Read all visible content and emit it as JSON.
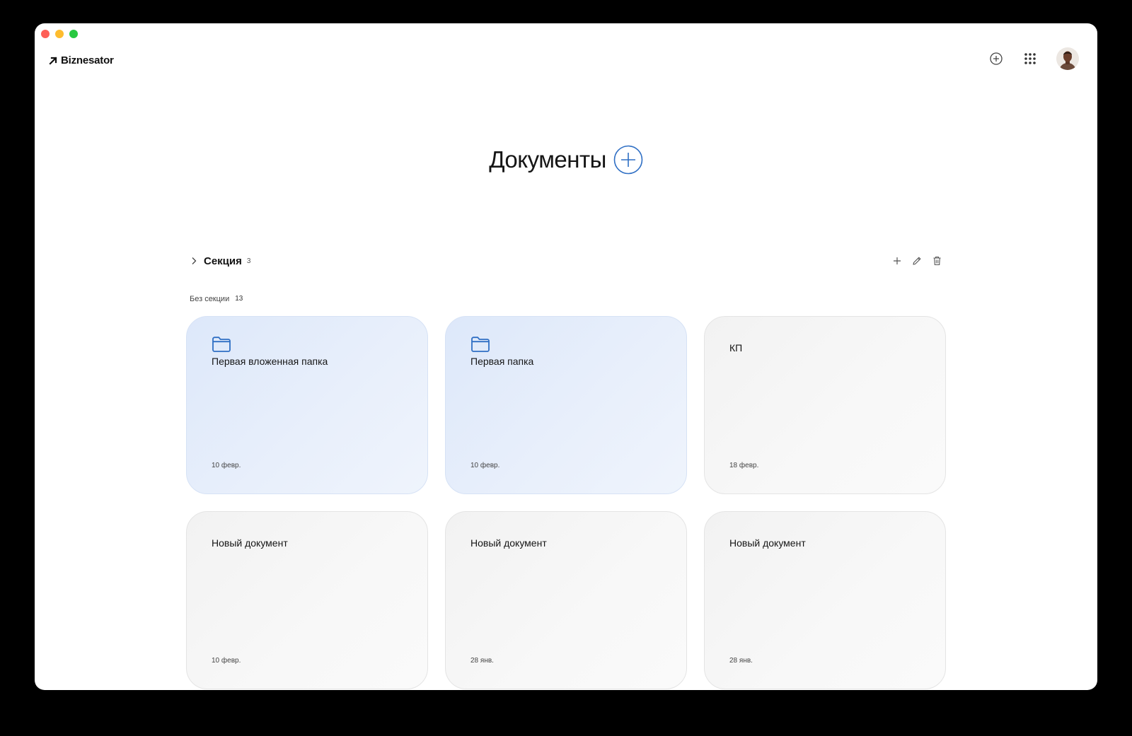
{
  "app": {
    "logo_text": "Biznesator"
  },
  "topbar": {
    "add_icon": "plus-circle-icon",
    "apps_icon": "grid-icon",
    "avatar_icon": "user-avatar"
  },
  "page": {
    "title": "Документы"
  },
  "section": {
    "name": "Секция",
    "count": "3"
  },
  "unsectioned": {
    "label": "Без секции",
    "count": "13"
  },
  "cards": [
    {
      "type": "folder",
      "title": "Первая вложенная папка",
      "date": "10 февр."
    },
    {
      "type": "folder",
      "title": "Первая папка",
      "date": "10 февр."
    },
    {
      "type": "doc",
      "title": "КП",
      "date": "18 февр."
    },
    {
      "type": "doc",
      "title": "Новый документ",
      "date": "10 февр."
    },
    {
      "type": "doc",
      "title": "Новый документ",
      "date": "28 янв."
    },
    {
      "type": "doc",
      "title": "Новый документ",
      "date": "28 янв."
    }
  ],
  "colors": {
    "accent": "#2f6fc4",
    "folder_card_bg": "#e4edfb",
    "doc_card_bg": "#f5f5f5"
  }
}
